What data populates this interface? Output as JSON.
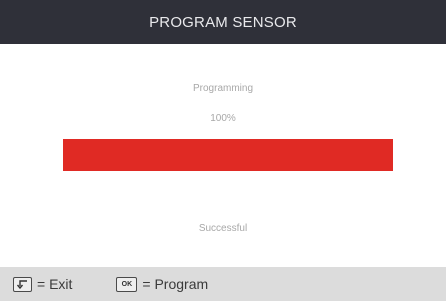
{
  "header": {
    "title": "PROGRAM SENSOR"
  },
  "main": {
    "status_label": "Programming",
    "progress_percent_text": "100%",
    "progress_value": 100,
    "result_text": "Successful"
  },
  "footer": {
    "exit_hint": "= Exit",
    "program_hint": "= Program",
    "back_key_icon": "back-arrow-key-icon",
    "ok_key_label": "OK"
  },
  "colors": {
    "title_bar": "#2f3039",
    "progress_fill": "#e02a24",
    "bottom_bar": "#dcdcdc"
  }
}
